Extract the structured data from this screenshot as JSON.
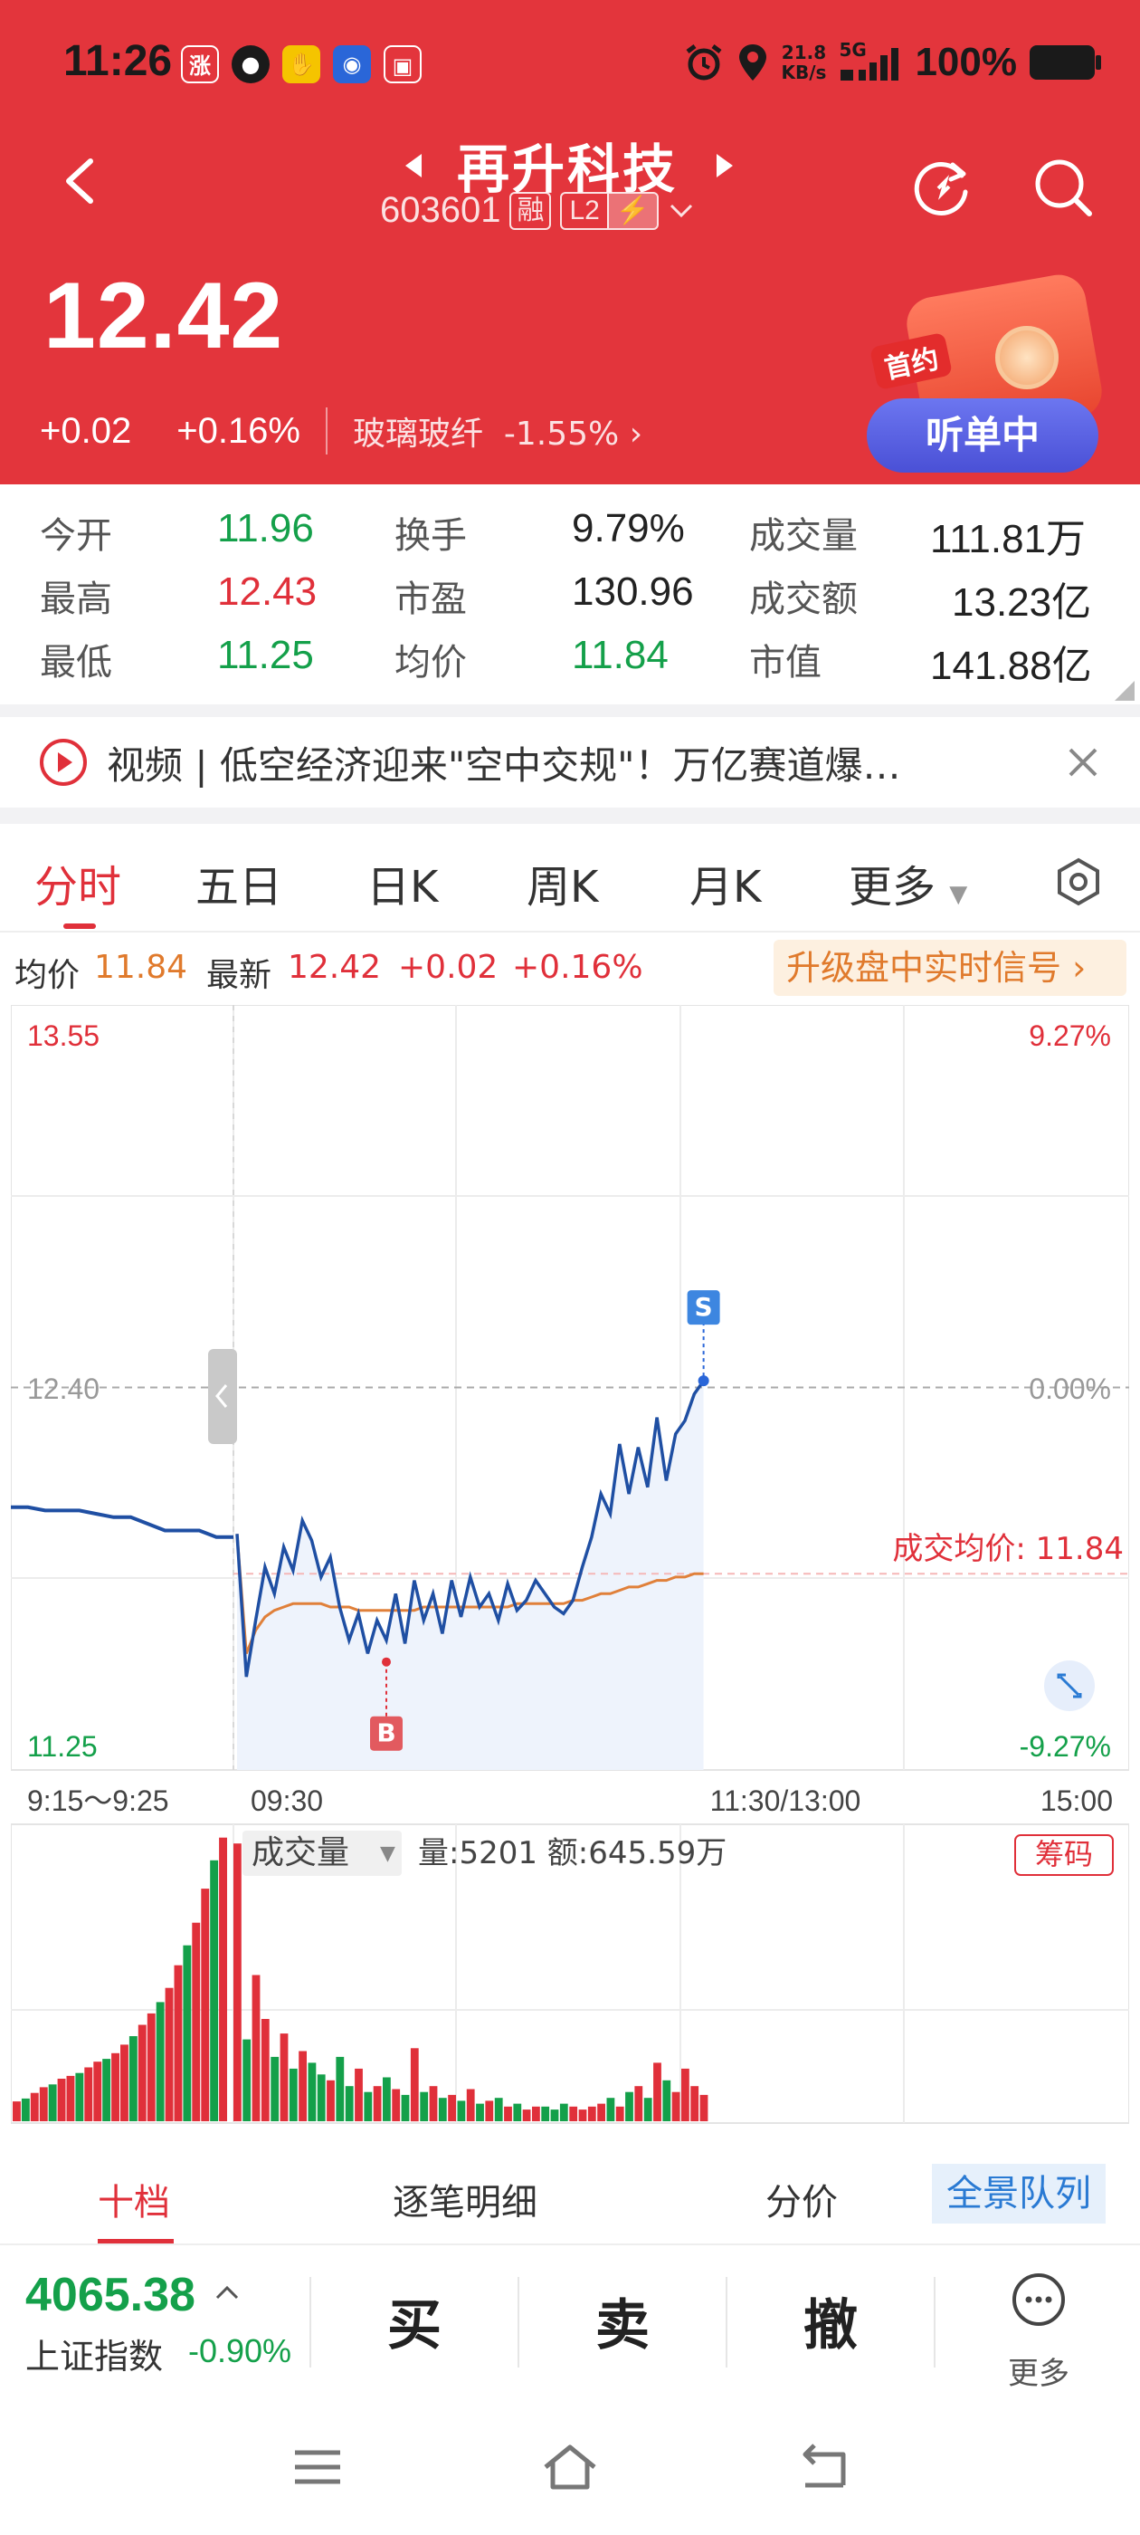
{
  "status_bar": {
    "time": "11:26",
    "net_speed_value": "21.8",
    "net_speed_unit": "KB/s",
    "network": "5G",
    "battery": "100%",
    "app_icons": [
      "zhang-icon",
      "wechat-icon",
      "hand-icon",
      "radio-icon",
      "tv-icon"
    ]
  },
  "header": {
    "stock_name": "再升科技",
    "stock_code": "603601",
    "margin_tag": "融",
    "level_tag": "L2",
    "price": "12.42",
    "change": "+0.02",
    "change_pct": "+0.16%",
    "industry_name": "玻璃玻纤",
    "industry_change": "-1.55%",
    "radio_tag": "首约",
    "listen_button": "听单中"
  },
  "stats": [
    {
      "label": "今开",
      "value": "11.96",
      "color": "green"
    },
    {
      "label": "换手",
      "value": "9.79%",
      "color": "black"
    },
    {
      "label": "成交量",
      "value": "111.81万",
      "color": "black"
    },
    {
      "label": "最高",
      "value": "12.43",
      "color": "red"
    },
    {
      "label": "市盈",
      "value": "130.96",
      "color": "black"
    },
    {
      "label": "成交额",
      "value": "13.23亿",
      "color": "black"
    },
    {
      "label": "最低",
      "value": "11.25",
      "color": "green"
    },
    {
      "label": "均价",
      "value": "11.84",
      "color": "green"
    },
    {
      "label": "市值",
      "value": "141.88亿",
      "color": "black"
    }
  ],
  "news": {
    "text": "视频 | 低空经济迎来\"空中交规\"！万亿赛道爆…"
  },
  "tabs": [
    "分时",
    "五日",
    "日K",
    "周K",
    "月K",
    "更多"
  ],
  "info_row": {
    "avg_label": "均价",
    "avg_value": "11.84",
    "latest_label": "最新",
    "latest_value": "12.42",
    "change": "+0.02",
    "change_pct": "+0.16%",
    "upgrade_text": "升级盘中实时信号"
  },
  "chart_data": {
    "type": "line",
    "y_max_label": "13.55",
    "y_mid_label": "12.40",
    "y_min_label": "11.25",
    "pct_max_label": "9.27%",
    "pct_mid_label": "0.00%",
    "pct_min_label": "-9.27%",
    "avg_price_label": "成交均价: 11.84",
    "x_labels": [
      "9:15～9:25",
      "09:30",
      "11:30/13:00",
      "15:00"
    ],
    "ylim": [
      11.25,
      13.55
    ],
    "pre_close": 12.4,
    "avg_price": 11.84,
    "buy_marker": "B",
    "sell_marker": "S",
    "auction_series": [
      12.04,
      12.04,
      12.03,
      12.03,
      12.03,
      12.02,
      12.01,
      12.01,
      11.99,
      11.97,
      11.97,
      11.97,
      11.95,
      11.95
    ],
    "price_series": [
      11.96,
      11.53,
      11.7,
      11.86,
      11.78,
      11.92,
      11.85,
      12.0,
      11.94,
      11.83,
      11.89,
      11.74,
      11.64,
      11.72,
      11.6,
      11.7,
      11.64,
      11.78,
      11.63,
      11.82,
      11.7,
      11.78,
      11.66,
      11.82,
      11.71,
      11.83,
      11.74,
      11.78,
      11.7,
      11.81,
      11.73,
      11.76,
      11.82,
      11.78,
      11.74,
      11.72,
      11.76,
      11.86,
      11.95,
      12.08,
      12.02,
      12.23,
      12.08,
      12.22,
      12.1,
      12.31,
      12.12,
      12.26,
      12.3,
      12.38,
      12.42
    ],
    "avg_series": [
      11.96,
      11.6,
      11.67,
      11.71,
      11.73,
      11.74,
      11.75,
      11.75,
      11.75,
      11.75,
      11.74,
      11.74,
      11.74,
      11.73,
      11.73,
      11.73,
      11.73,
      11.73,
      11.73,
      11.73,
      11.74,
      11.74,
      11.74,
      11.74,
      11.74,
      11.74,
      11.74,
      11.74,
      11.74,
      11.74,
      11.75,
      11.75,
      11.75,
      11.75,
      11.75,
      11.75,
      11.76,
      11.76,
      11.77,
      11.78,
      11.78,
      11.79,
      11.8,
      11.8,
      11.81,
      11.82,
      11.82,
      11.83,
      11.83,
      11.84,
      11.84
    ],
    "volume_title": "成交量",
    "volume_text": "量:5201 额:645.59万",
    "chip_label": "筹码",
    "auction_volume": [
      0.07,
      0.08,
      0.1,
      0.12,
      0.13,
      0.15,
      0.16,
      0.17,
      0.19,
      0.21,
      0.22,
      0.24,
      0.27,
      0.3,
      0.34,
      0.38,
      0.42,
      0.47,
      0.55,
      0.62,
      0.7,
      0.82,
      0.92,
      1.0
    ],
    "volume_series": [
      0.95,
      0.28,
      0.5,
      0.35,
      0.22,
      0.3,
      0.18,
      0.24,
      0.2,
      0.16,
      0.14,
      0.22,
      0.12,
      0.18,
      0.1,
      0.12,
      0.15,
      0.11,
      0.09,
      0.25,
      0.1,
      0.12,
      0.08,
      0.09,
      0.07,
      0.11,
      0.06,
      0.07,
      0.08,
      0.05,
      0.06,
      0.04,
      0.05,
      0.05,
      0.04,
      0.06,
      0.05,
      0.04,
      0.05,
      0.06,
      0.08,
      0.05,
      0.1,
      0.12,
      0.08,
      0.2,
      0.14,
      0.1,
      0.18,
      0.12,
      0.09
    ]
  },
  "order_tabs": [
    "十档",
    "逐笔明细",
    "分价",
    "全景队列"
  ],
  "bottom_bar": {
    "index_value": "4065.38",
    "index_name": "上证指数",
    "index_change": "-0.90%",
    "buy": "买",
    "sell": "卖",
    "cancel": "撤",
    "more": "更多"
  },
  "colors": {
    "brand_red": "#e3353c",
    "up": "#e0303a",
    "down": "#14a04a",
    "price_line": "#1f4fa3",
    "avg_line": "#e0803a",
    "listen_button": "#5a60e0"
  }
}
